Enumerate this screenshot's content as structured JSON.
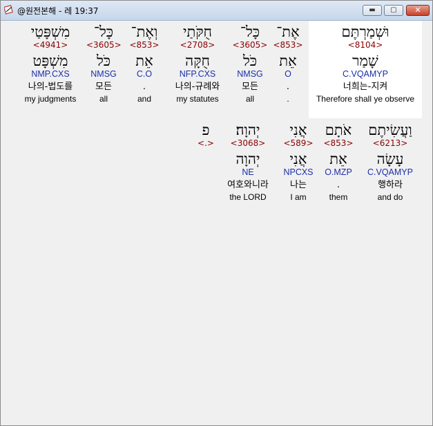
{
  "window": {
    "title": "@원전본해 - 레 19:37",
    "controls": {
      "minimize": "▬",
      "maximize": "▢",
      "close": "✕"
    },
    "app_icon": "bible-app-icon"
  },
  "rows": [
    {
      "words": [
        {
          "heb": "וּשְׁמַרְתֶּם",
          "num": "<8104>",
          "lemma": "שָׁמַר",
          "morph": "C.VQAMYP",
          "kor": "너희는-지켜",
          "eng": "Therefore shall ye observe",
          "highlighted": true
        },
        {
          "heb": "אֶת־",
          "num": "<853>",
          "lemma": "אֵת",
          "morph": "O",
          "kor": ".",
          "eng": "."
        },
        {
          "heb": "כָּל־",
          "num": "<3605>",
          "lemma": "כֹּל",
          "morph": "NMSG",
          "kor": "모든",
          "eng": "all"
        },
        {
          "heb": "חֻקֹּתַי",
          "num": "<2708>",
          "lemma": "חֻקָּה",
          "morph": "NFP.CXS",
          "kor": "나의-규례와",
          "eng": "my statutes"
        },
        {
          "heb": "וְאֶת־",
          "num": "<853>",
          "lemma": "אֵת",
          "morph": "C.O",
          "kor": ".",
          "eng": "and"
        },
        {
          "heb": "כָּל־",
          "num": "<3605>",
          "lemma": "כֹּל",
          "morph": "NMSG",
          "kor": "모든",
          "eng": "all"
        },
        {
          "heb": "מִשְׁפָּטַי",
          "num": "<4941>",
          "lemma": "מִשְׁפָּט",
          "morph": "NMP.CXS",
          "kor": "나의-법도를",
          "eng": "my judgments"
        }
      ]
    },
    {
      "words": [
        {
          "heb": "וַעֲשִׂיתֶם",
          "num": "<6213>",
          "lemma": "עָשָׂה",
          "morph": "C.VQAMYP",
          "kor": "행하라",
          "eng": "and do"
        },
        {
          "heb": "אֹתָם",
          "num": "<853>",
          "lemma": "אֵת",
          "morph": "O.MZP",
          "kor": ".",
          "eng": "them"
        },
        {
          "heb": "אֲנִי",
          "num": "<589>",
          "lemma": "אֲנִי",
          "morph": "NPCXS",
          "kor": "나는",
          "eng": "I am"
        },
        {
          "heb": "יְהוָה׃",
          "num": "<3068>",
          "lemma": "יְהוָה",
          "morph": "NE",
          "kor": "여호와니라",
          "eng": "the LORD"
        },
        {
          "heb": "פ",
          "num": "<.>",
          "lemma": "",
          "morph": "",
          "kor": "",
          "eng": ""
        }
      ]
    }
  ]
}
